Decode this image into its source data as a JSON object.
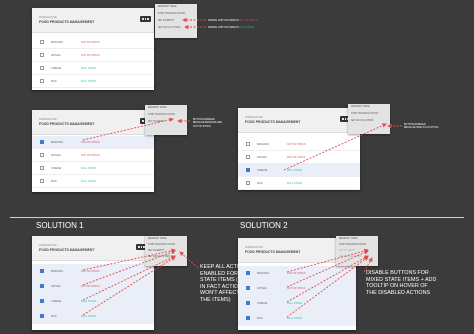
{
  "app": {
    "eyebrow": "WAREHOUSE",
    "title": "FOOD PRODUCTS MANAGEMENT",
    "rows": [
      {
        "name": "BANANAS",
        "status": "OUT OF STOCK",
        "tone": "out"
      },
      {
        "name": "APPLES",
        "status": "OUT OF STOCK",
        "tone": "out"
      },
      {
        "name": "CHEESE",
        "status": "FULL STOCK",
        "tone": "full"
      },
      {
        "name": "MILK",
        "status": "FULL STOCK",
        "tone": "full"
      }
    ],
    "menu": {
      "refresh": "REFRESH TABLE",
      "stop": "STOP TRACKING STOCK",
      "empty": "SET AS EMPTY",
      "full": "SET AS FULL STOCK",
      "remove": "REMOVE ITEM"
    }
  },
  "notes": {
    "top": [
      {
        "pre": "WORKS JUST ON ITEMS IN ",
        "hl": "OUT OF STOCK",
        "tone": "out"
      },
      {
        "pre": "WORKS JUST ON ITEMS IN ",
        "hl": "FULL STOCK",
        "tone": "full"
      }
    ],
    "mid_left": [
      "BUTTON ENABLED",
      "BECAUSE BANANAS ARE",
      "OUT OF STOCK"
    ],
    "mid_right": [
      "BUTTON ENABLED",
      "BECAUSE ITEM 3 IS IN STOCK"
    ],
    "solution1": [
      "KEEP ALL ACTIONS",
      "ENABLED FOR MIXED",
      "STATE ITEMS (EVEN IF",
      "IN FACT ACTION",
      "WON'T AFFECT ALL",
      "THE ITEMS)"
    ],
    "solution2": [
      "DISABLE BUTTONS FOR",
      "MIXED STATE ITEMS + ADD",
      "TOOLTIP ON HOVER OF",
      "THE DISABLED ACTIONS"
    ]
  },
  "solutions": {
    "one": "SOLUTION 1",
    "two": "SOLUTION 2"
  },
  "colors": {
    "background": "#3b3b3b",
    "out_of_stock": "#e24b4b",
    "full_stock": "#2fb99c",
    "checkbox": "#3d7cc9",
    "arrow": "#e24b4b"
  }
}
